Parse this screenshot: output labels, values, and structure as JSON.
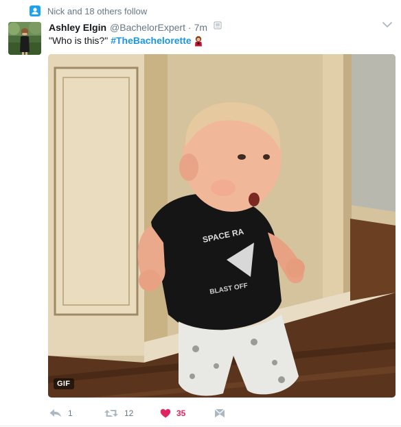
{
  "context": {
    "text": "Nick and 18 others follow",
    "icon": "follow-person-icon"
  },
  "tweet": {
    "author_name": "Ashley Elgin",
    "author_handle": "@BachelorExpert",
    "separator": "·",
    "timestamp": "7m",
    "text": "\"Who is this?\"",
    "hashtag": "#TheBachelorette",
    "media": {
      "badge": "GIF"
    }
  },
  "actions": {
    "reply_count": "1",
    "retweet_count": "12",
    "like_count": "35"
  },
  "colors": {
    "link": "#1b95e0",
    "like": "#e0245e",
    "secondary_text": "#657786"
  }
}
